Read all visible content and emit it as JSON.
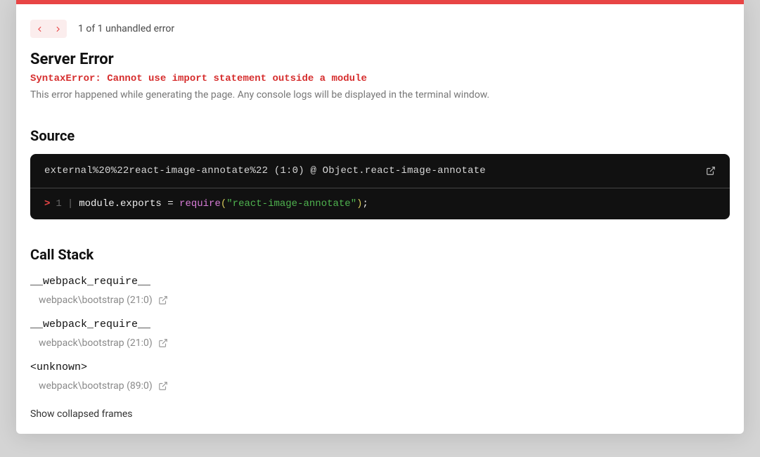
{
  "nav": {
    "count_text": "1 of 1 unhandled error"
  },
  "header": {
    "title": "Server Error",
    "error_message": "SyntaxError: Cannot use import statement outside a module",
    "description": "This error happened while generating the page. Any console logs will be displayed in the terminal window."
  },
  "source": {
    "heading": "Source",
    "location": "external%20%22react-image-annotate%22 (1:0) @ Object.react-image-annotate",
    "line_number": "1",
    "code": {
      "pre": "module.exports = ",
      "fn": "require",
      "str": "\"react-image-annotate\""
    }
  },
  "callstack": {
    "heading": "Call Stack",
    "frames": [
      {
        "name": "__webpack_require__",
        "loc": "webpack\\bootstrap (21:0)"
      },
      {
        "name": "__webpack_require__",
        "loc": "webpack\\bootstrap (21:0)"
      },
      {
        "name": "<unknown>",
        "loc": "webpack\\bootstrap (89:0)"
      }
    ],
    "show_collapsed": "Show collapsed frames"
  }
}
